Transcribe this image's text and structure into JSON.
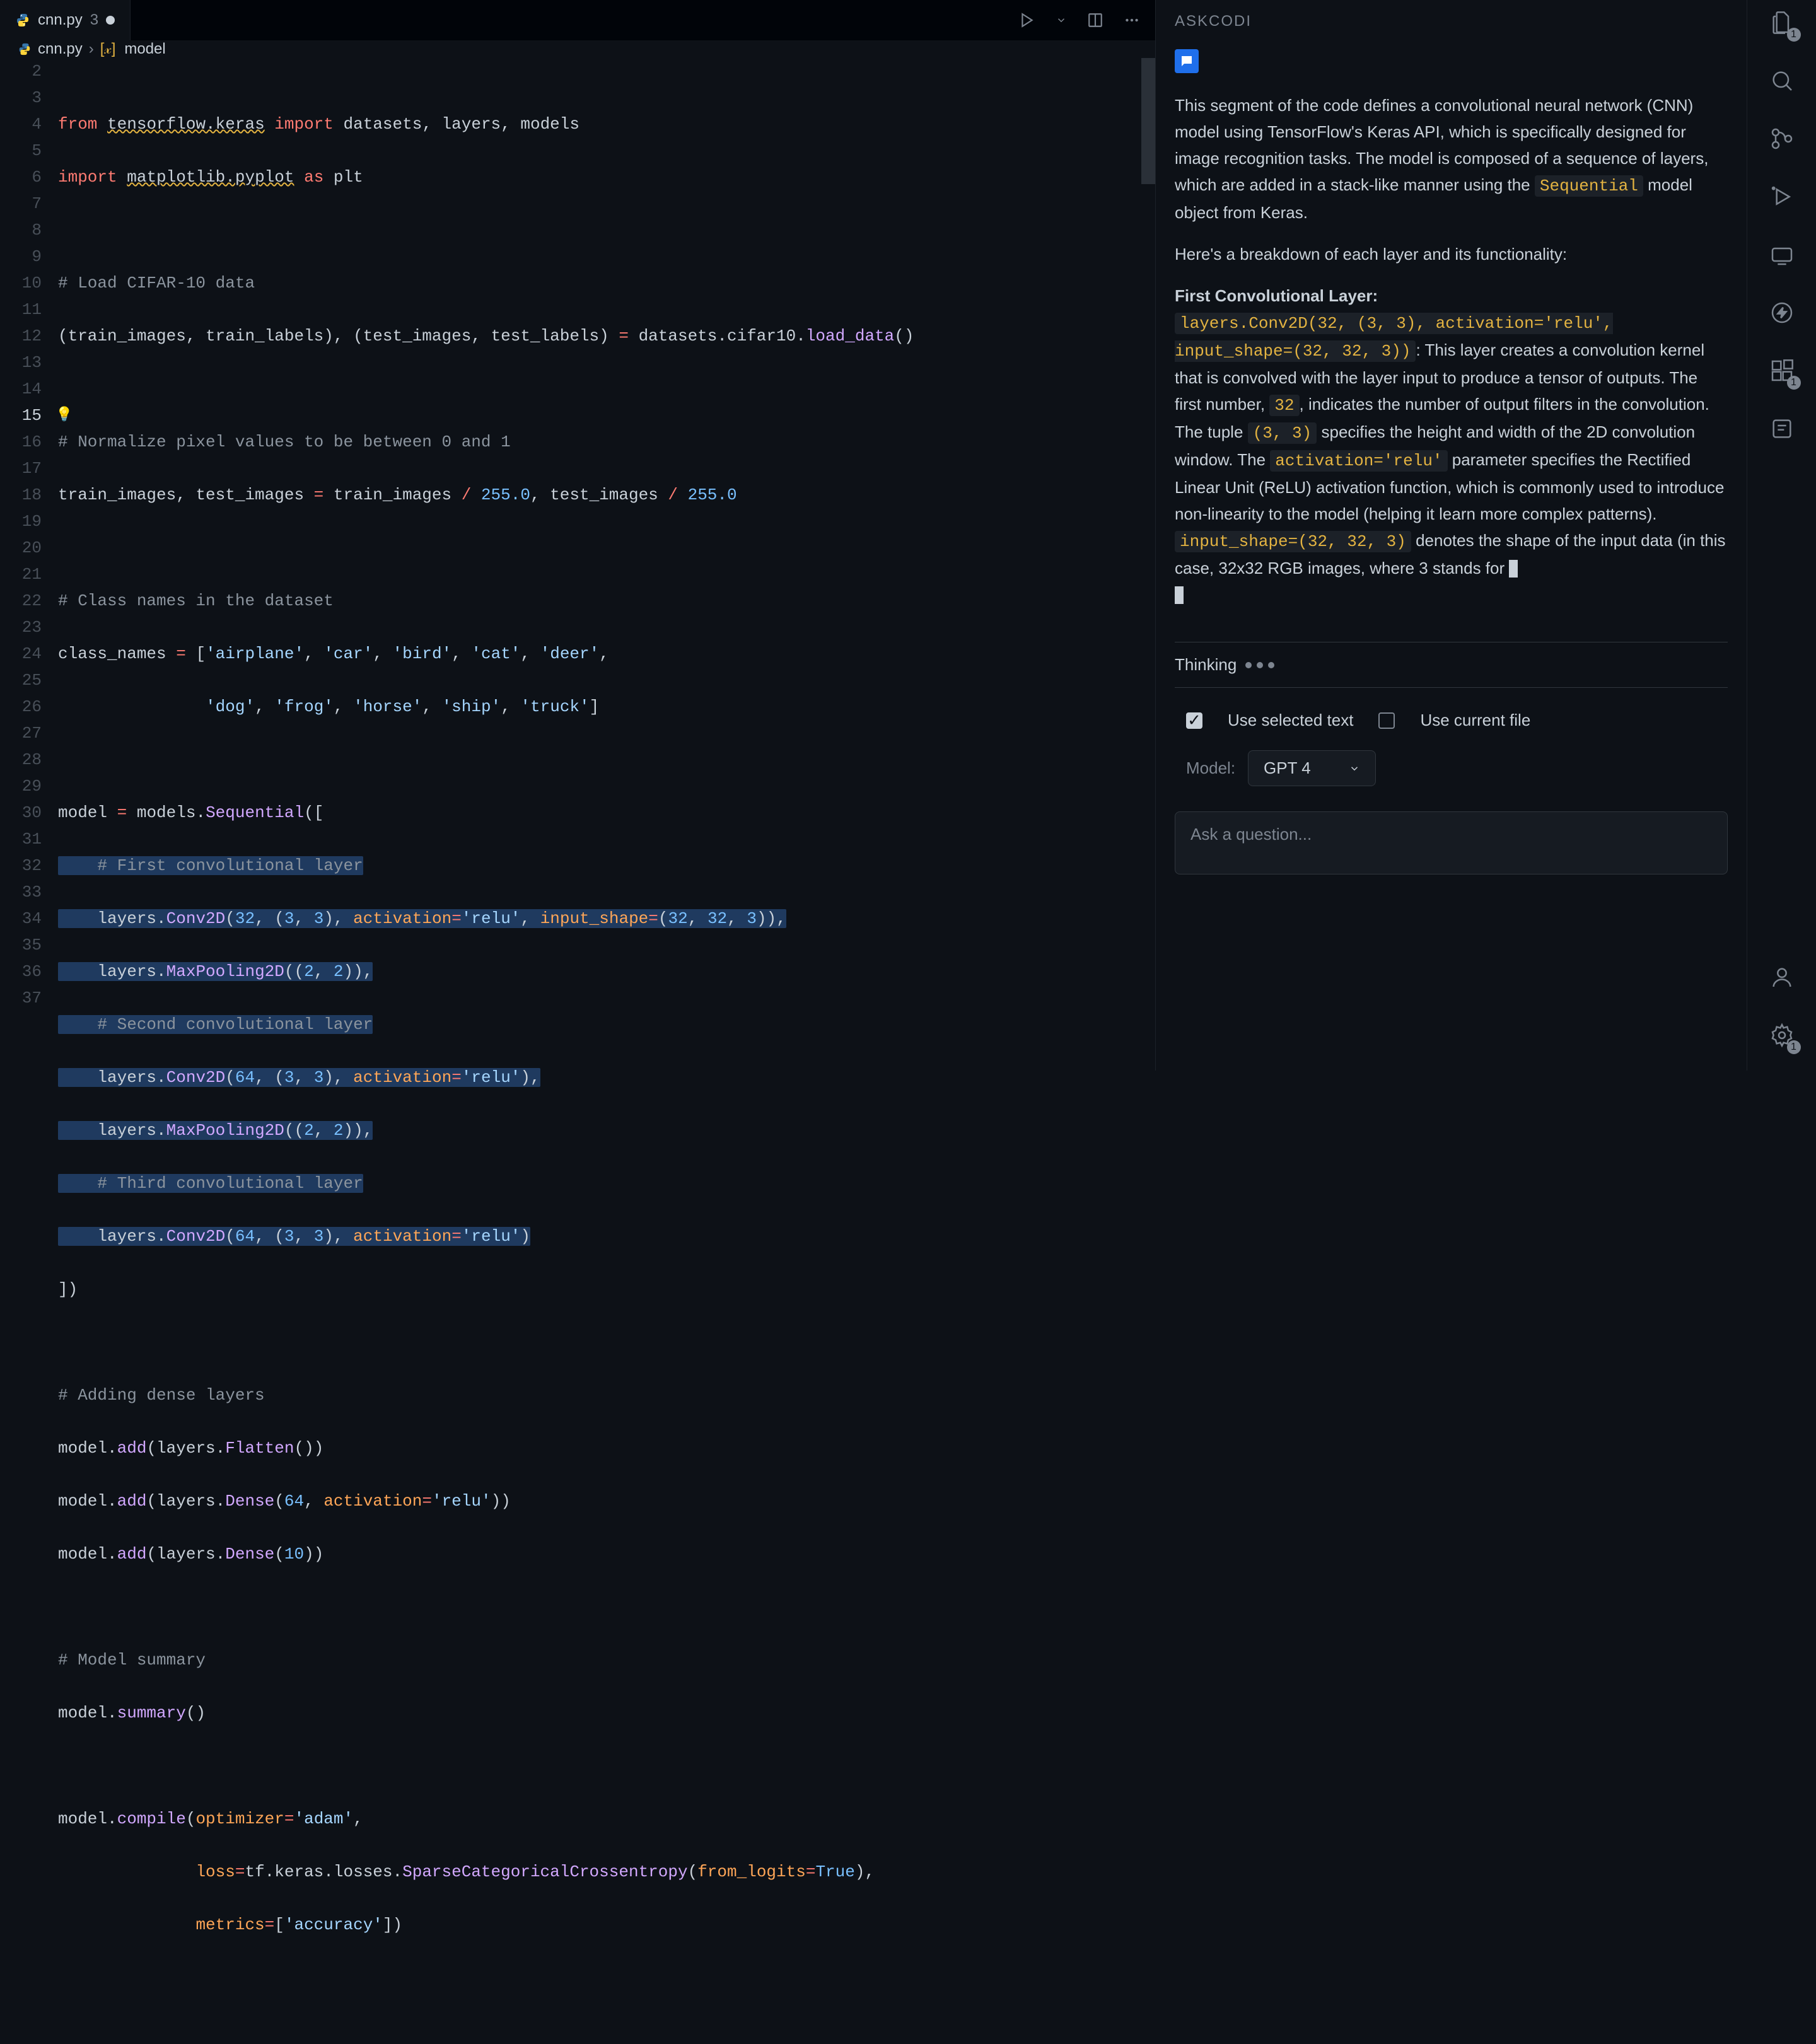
{
  "tab": {
    "filename": "cnn.py",
    "badge": "3"
  },
  "breadcrumb": {
    "file": "cnn.py",
    "symbol": "model"
  },
  "lines": {
    "start": 2,
    "end": 37,
    "active": 15
  },
  "code": {
    "l2": {
      "kw1": "from",
      "mod1": "tensorflow.keras",
      "kw2": "import",
      "items": "datasets, layers, models"
    },
    "l3": {
      "kw1": "import",
      "mod1": "matplotlib.pyplot",
      "kw2": "as",
      "alias": "plt"
    },
    "l5": "# Load CIFAR-10 data",
    "l6": {
      "lhs": "(train_images, train_labels), (test_images, test_labels) ",
      "op": "=",
      "rhs1": " datasets.cifar10.",
      "fn": "load_data",
      "rhs2": "()"
    },
    "l8": "# Normalize pixel values to be between 0 and 1",
    "l9": {
      "txt1": "train_images, test_images ",
      "op": "=",
      "txt2": " train_images ",
      "div": "/",
      "num1": " 255.0",
      "comma": ", test_images ",
      "div2": "/",
      "num2": " 255.0"
    },
    "l11": "# Class names in the dataset",
    "l12": {
      "var": "class_names ",
      "op": "=",
      "txt": " [",
      "s1": "'airplane'",
      "c": ", ",
      "s2": "'car'",
      "s3": "'bird'",
      "s4": "'cat'",
      "s5": "'deer'",
      "end": ","
    },
    "l13": {
      "s1": "'dog'",
      "s2": "'frog'",
      "s3": "'horse'",
      "s4": "'ship'",
      "s5": "'truck'",
      "end": "]"
    },
    "l15": {
      "var": "model ",
      "op": "=",
      "mod": " models.",
      "fn": "Sequential",
      "p": "(["
    },
    "l16": "    # First convolutional layer",
    "l17": {
      "pre": "    layers.",
      "fn": "Conv2D",
      "o": "(",
      "n1": "32",
      "c1": ", (",
      "n2": "3",
      "c2": ", ",
      "n3": "3",
      "c3": "), ",
      "p1": "activation",
      "e": "=",
      "s1": "'relu'",
      "c4": ", ",
      "p2": "input_shape",
      "e2": "=",
      "o2": "(",
      "n4": "32",
      "c5": ", ",
      "n5": "32",
      "c6": ", ",
      "n6": "3",
      "end": ")),"
    },
    "l18": {
      "pre": "    layers.",
      "fn": "MaxPooling2D",
      "o": "((",
      "n1": "2",
      "c": ", ",
      "n2": "2",
      "end": ")),"
    },
    "l19": "    # Second convolutional layer",
    "l20": {
      "pre": "    layers.",
      "fn": "Conv2D",
      "o": "(",
      "n1": "64",
      "c1": ", (",
      "n2": "3",
      "c2": ", ",
      "n3": "3",
      "c3": "), ",
      "p1": "activation",
      "e": "=",
      "s1": "'relu'",
      "end": "),"
    },
    "l21": {
      "pre": "    layers.",
      "fn": "MaxPooling2D",
      "o": "((",
      "n1": "2",
      "c": ", ",
      "n2": "2",
      "end": ")),"
    },
    "l22": "    # Third convolutional layer",
    "l23": {
      "pre": "    layers.",
      "fn": "Conv2D",
      "o": "(",
      "n1": "64",
      "c1": ", (",
      "n2": "3",
      "c2": ", ",
      "n3": "3",
      "c3": "), ",
      "p1": "activation",
      "e": "=",
      "s1": "'relu'",
      "end": ")"
    },
    "l24": "])",
    "l26": "# Adding dense layers",
    "l27": {
      "pre": "model.",
      "fn": "add",
      "o": "(layers.",
      "fn2": "Flatten",
      "end": "())"
    },
    "l28": {
      "pre": "model.",
      "fn": "add",
      "o": "(layers.",
      "fn2": "Dense",
      "o2": "(",
      "n1": "64",
      "c": ", ",
      "p1": "activation",
      "e": "=",
      "s1": "'relu'",
      "end": "))"
    },
    "l29": {
      "pre": "model.",
      "fn": "add",
      "o": "(layers.",
      "fn2": "Dense",
      "o2": "(",
      "n1": "10",
      "end": "))"
    },
    "l31": "# Model summary",
    "l32": {
      "pre": "model.",
      "fn": "summary",
      "end": "()"
    },
    "l34": {
      "pre": "model.",
      "fn": "compile",
      "o": "(",
      "p1": "optimizer",
      "e": "=",
      "s1": "'adam'",
      "end": ","
    },
    "l35": {
      "p1": "loss",
      "e": "=",
      "mod": "tf.keras.losses.",
      "fn": "SparseCategoricalCrossentropy",
      "o": "(",
      "p2": "from_logits",
      "e2": "=",
      "val": "True",
      "end": "),"
    },
    "l36": {
      "p1": "metrics",
      "e": "=",
      "o": "[",
      "s1": "'accuracy'",
      "end": "])"
    }
  },
  "sidebar": {
    "header": "ASKCODI",
    "p1_a": "This segment of the code defines a convolutional neural network (CNN) model using TensorFlow's Keras API, which is specifically designed for image recognition tasks. The model is composed of a sequence of layers, which are added in a stack-like manner using the ",
    "p1_code": "Sequential",
    "p1_b": " model object from Keras.",
    "p2": "Here's a breakdown of each layer and its functionality:",
    "h1": "First Convolutional Layer:",
    "code1": "layers.Conv2D(32, (3, 3), activation='relu', input_shape=(32, 32, 3))",
    "p3_a": ": This layer creates a convolution kernel that is convolved with the layer input to produce a tensor of outputs. The first number, ",
    "code2": "32",
    "p3_b": ", indicates the number of output filters in the convolution. The tuple ",
    "code3": "(3, 3)",
    "p3_c": " specifies the height and width of the 2D convolution window. The ",
    "code4": "activation='relu'",
    "p3_d": " parameter specifies the Rectified Linear Unit (ReLU) activation function, which is commonly used to introduce non-linearity to the model (helping it learn more complex patterns). ",
    "code5": "input_shape=(32, 32, 3)",
    "p3_e": " denotes the shape of the input data (in this case, 32x32 RGB images, where 3 stands for "
  },
  "thinking": "Thinking",
  "options": {
    "selected_text": "Use selected text",
    "current_file": "Use current file"
  },
  "model": {
    "label": "Model:",
    "value": "GPT 4"
  },
  "input_placeholder": "Ask a question...",
  "activity_badges": {
    "files": "1",
    "ext": "1",
    "settings": "1"
  }
}
